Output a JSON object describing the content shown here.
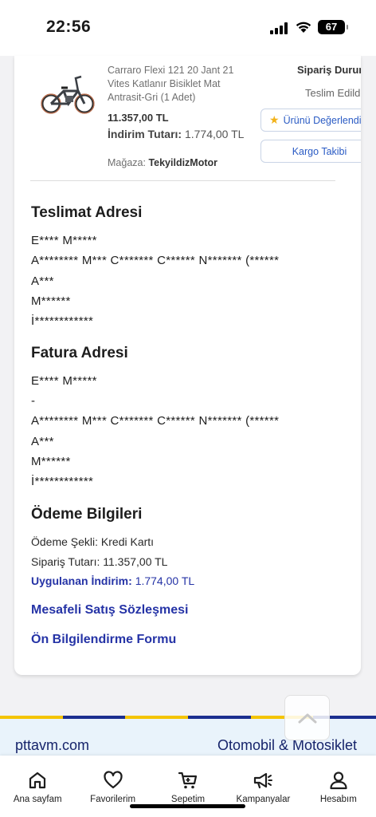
{
  "status_bar": {
    "time": "22:56",
    "battery": "67"
  },
  "product": {
    "name": "Carraro Flexi 121 20 Jant 21 Vites Katlanır Bisiklet Mat Antrasit-Gri (1 Adet)",
    "price": "11.357,00 TL",
    "discount_label": "İndirim Tutarı:",
    "discount_value": "1.774,00 TL",
    "store_label": "Mağaza:",
    "store_name": "TekyildizMotor"
  },
  "order": {
    "status_label": "Sipariş Durumu",
    "delivery_status": "Teslim Edildi",
    "rate_button": "Ürünü Değerlendir",
    "track_button": "Kargo Takibi"
  },
  "delivery_address": {
    "title": "Teslimat Adresi",
    "lines": [
      "E**** M*****",
      "A******** M*** C******* C****** N******* (******",
      "A***",
      "M******",
      "İ************"
    ]
  },
  "billing_address": {
    "title": "Fatura Adresi",
    "lines": [
      "E**** M*****",
      "-",
      "A******** M*** C******* C****** N******* (******",
      "A***",
      "M******",
      "İ************"
    ]
  },
  "payment": {
    "title": "Ödeme Bilgileri",
    "method": "Ödeme Şekli: Kredi Kartı",
    "total": "Sipariş Tutarı: 11.357,00 TL",
    "discount_label": "Uygulanan İndirim:",
    "discount_value": "1.774,00 TL",
    "link_contract": "Mesafeli Satış Sözleşmesi",
    "link_form": "Ön Bilgilendirme Formu"
  },
  "footer": {
    "left": "pttavm.com",
    "right": "Otomobil & Motosiklet",
    "stripe_colors": [
      "#f4c400",
      "#1c2f8f",
      "#f4c400",
      "#1c2f8f",
      "#f4c400",
      "#1c2f8f"
    ]
  },
  "tabs": [
    {
      "label": "Ana sayfam",
      "icon": "home-icon"
    },
    {
      "label": "Favorilerim",
      "icon": "heart-icon"
    },
    {
      "label": "Sepetim",
      "icon": "cart-icon"
    },
    {
      "label": "Kampanyalar",
      "icon": "megaphone-icon"
    },
    {
      "label": "Hesabım",
      "icon": "user-icon"
    }
  ],
  "colors": {
    "link": "#2533a6",
    "accent_blue": "#2a5bc4",
    "star": "#f2b21a",
    "footer_text": "#16246b"
  }
}
